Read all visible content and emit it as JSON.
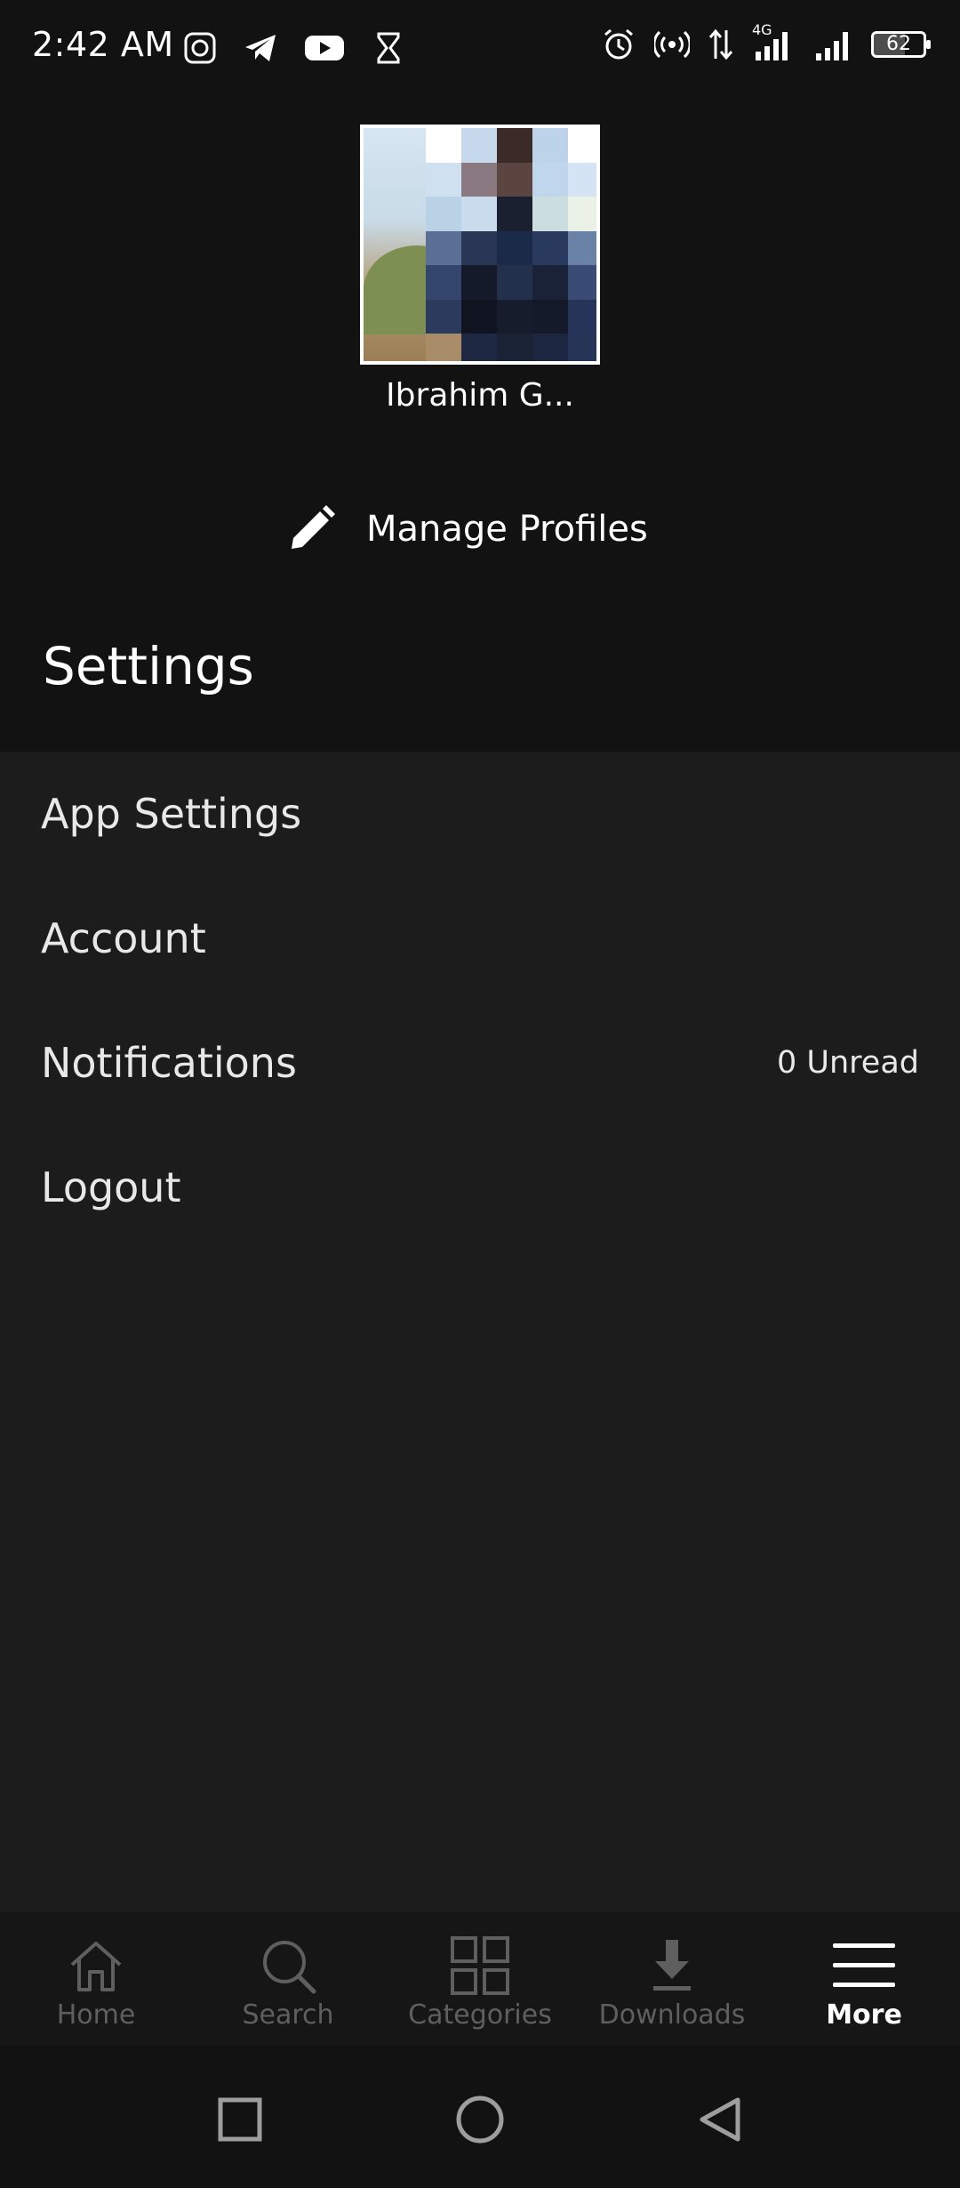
{
  "status_bar": {
    "time": "2:42 AM",
    "battery_level": "62",
    "network_label": "4G",
    "left_icons": [
      "app-badge-icon",
      "telegram-icon",
      "youtube-icon",
      "hourglass-icon"
    ],
    "right_icons": [
      "alarm-icon",
      "hotspot-icon",
      "data-transfer-icon",
      "signal-4g-icon",
      "signal-icon",
      "battery-icon"
    ]
  },
  "profile": {
    "name": "Ibrahim G..."
  },
  "manage_profiles": {
    "label": "Manage Profiles",
    "icon": "pencil-icon"
  },
  "settings": {
    "title": "Settings",
    "items": [
      {
        "label": "App Settings",
        "meta": ""
      },
      {
        "label": "Account",
        "meta": ""
      },
      {
        "label": "Notifications",
        "meta": "0 Unread"
      },
      {
        "label": "Logout",
        "meta": ""
      }
    ]
  },
  "bottom_nav": {
    "items": [
      {
        "label": "Home",
        "icon": "home-icon",
        "active": false
      },
      {
        "label": "Search",
        "icon": "search-icon",
        "active": false
      },
      {
        "label": "Categories",
        "icon": "categories-icon",
        "active": false
      },
      {
        "label": "Downloads",
        "icon": "download-icon",
        "active": false
      },
      {
        "label": "More",
        "icon": "menu-icon",
        "active": true
      }
    ]
  },
  "system_nav": {
    "buttons": [
      "recents-icon",
      "home-circle-icon",
      "back-icon"
    ]
  },
  "colors": {
    "background": "#121212",
    "panel": "#1c1c1c",
    "nav_background": "#161616",
    "text_primary": "#ffffff",
    "text_inactive": "#5f5f5f"
  }
}
